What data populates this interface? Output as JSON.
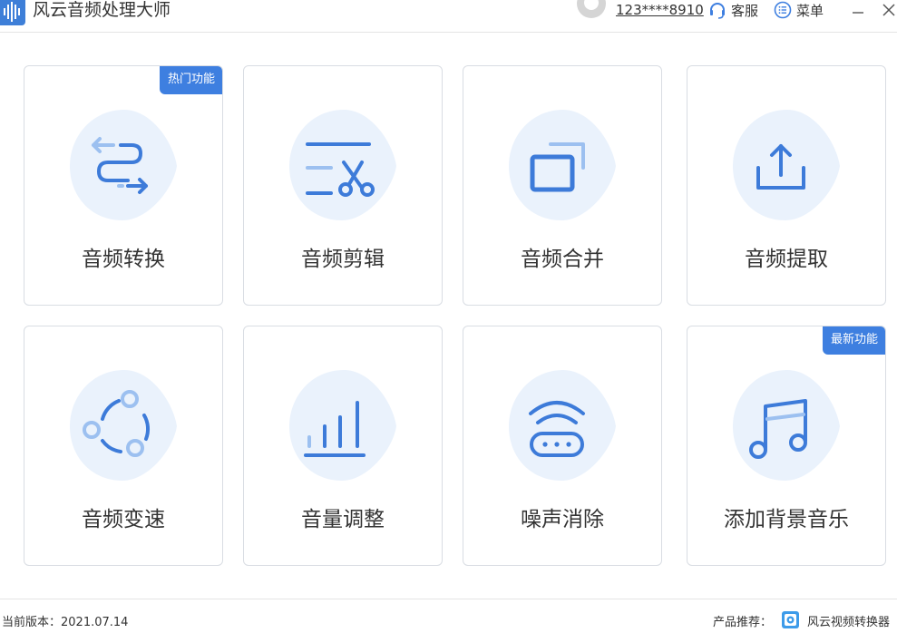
{
  "app": {
    "title": "风云音频处理大师",
    "logo_icon": "audio-wave-icon"
  },
  "header": {
    "user_id": "123****8910",
    "service_label": "客服",
    "service_icon": "headset-icon",
    "menu_label": "菜单",
    "menu_icon": "list-circle-icon"
  },
  "cards": [
    {
      "label": "音频转换",
      "icon": "convert-arrows-icon",
      "badge": "热门功能"
    },
    {
      "label": "音频剪辑",
      "icon": "scissors-edit-icon",
      "badge": ""
    },
    {
      "label": "音频合并",
      "icon": "merge-windows-icon",
      "badge": ""
    },
    {
      "label": "音频提取",
      "icon": "upload-extract-icon",
      "badge": ""
    },
    {
      "label": "音频变速",
      "icon": "speed-cycle-icon",
      "badge": ""
    },
    {
      "label": "音量调整",
      "icon": "volume-bars-icon",
      "badge": ""
    },
    {
      "label": "噪声消除",
      "icon": "noise-router-icon",
      "badge": ""
    },
    {
      "label": "添加背景音乐",
      "icon": "music-note-icon",
      "badge": "最新功能"
    }
  ],
  "footer": {
    "version": "当前版本：2021.07.14",
    "recommend_label": "产品推荐：",
    "recommend_app": "风云视频转换器"
  },
  "colors": {
    "accent": "#3e7fe0",
    "icon_blue": "#3d7bd9",
    "icon_light": "#9cc0f0",
    "blob": "#eaf2fc",
    "border": "#d9dde3"
  }
}
